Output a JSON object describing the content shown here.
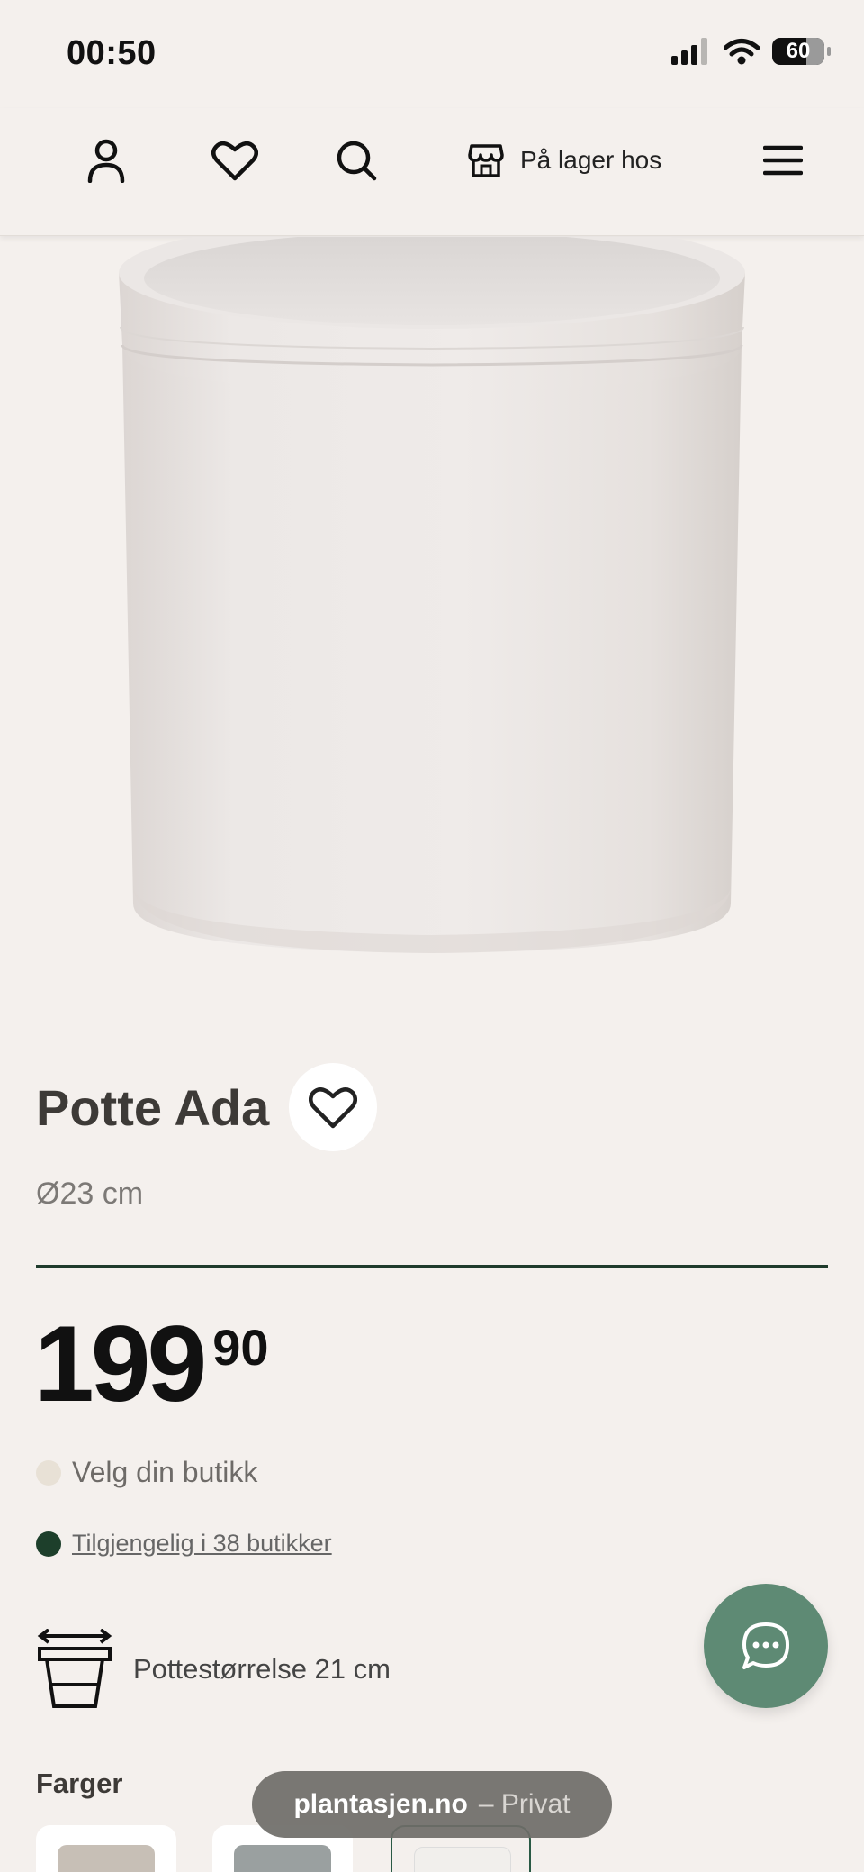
{
  "status_bar": {
    "time": "00:50",
    "battery": "60"
  },
  "nav": {
    "account_icon": "user-icon",
    "favorites_icon": "heart-icon",
    "search_icon": "search-icon",
    "store_icon": "store-icon",
    "store_label": "På lager hos",
    "menu_icon": "hamburger-menu-icon"
  },
  "product": {
    "title": "Potte Ada",
    "size": "Ø23 cm",
    "price_main": "199",
    "price_cents": "90",
    "choose_store": "Velg din butikk",
    "availability": "Tilgjengelig i 38 butikker",
    "pot_size": "Pottestørrelse 21 cm",
    "colors_heading": "Farger"
  },
  "colors": {
    "accent": "#1f3b2c",
    "chat_button": "#5e8a74",
    "choose_store_dot": "#e8e1d6",
    "available_dot": "#1d3f2b",
    "swatches": [
      "#c7bfb6",
      "#9aa0a0",
      "#f1efec"
    ]
  },
  "browser": {
    "domain": "plantasjen.no",
    "mode": "– Privat"
  }
}
